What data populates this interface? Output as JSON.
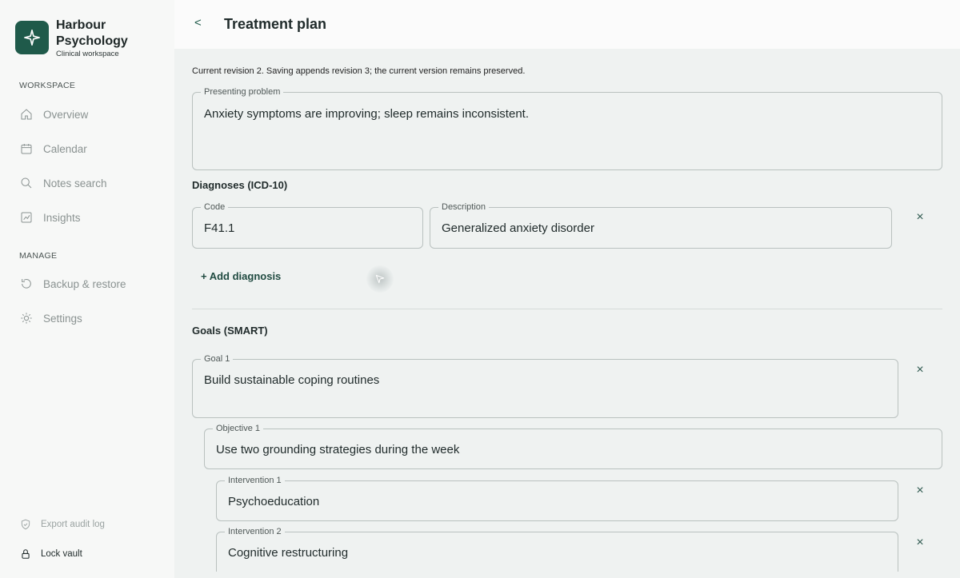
{
  "brand": {
    "name_line1": "Harbour",
    "name_line2": "Psychology",
    "subtitle": "Clinical workspace",
    "logo_icon": "sparkle-icon"
  },
  "sidebar": {
    "workspace_label": "WORKSPACE",
    "workspace_items": [
      {
        "label": "Overview",
        "icon": "home-icon"
      },
      {
        "label": "Calendar",
        "icon": "calendar-icon"
      },
      {
        "label": "Notes search",
        "icon": "search-icon"
      },
      {
        "label": "Insights",
        "icon": "chart-icon"
      }
    ],
    "manage_label": "MANAGE",
    "manage_items": [
      {
        "label": "Backup & restore",
        "icon": "restore-icon"
      },
      {
        "label": "Settings",
        "icon": "gear-icon"
      }
    ],
    "footer": {
      "export_label": "Export audit log",
      "lock_label": "Lock vault"
    }
  },
  "header": {
    "back_label": "<",
    "title": "Treatment plan"
  },
  "main": {
    "revision_note": "Current revision 2. Saving appends revision 3; the current version remains preserved.",
    "presenting_problem": {
      "label": "Presenting problem",
      "value": "Anxiety symptoms are improving; sleep remains inconsistent."
    },
    "diagnoses": {
      "title": "Diagnoses (ICD-10)",
      "code_label": "Code",
      "code_value": "F41.1",
      "description_label": "Description",
      "description_value": "Generalized anxiety disorder",
      "remove_label": "×",
      "add_label": "+ Add diagnosis"
    },
    "goals": {
      "title": "Goals (SMART)",
      "goal1_label": "Goal 1",
      "goal1_value": "Build sustainable coping routines",
      "objective1_label": "Objective 1",
      "objective1_value": "Use two grounding strategies during the week",
      "intervention1_label": "Intervention 1",
      "intervention1_value": "Psychoeducation",
      "intervention2_label": "Intervention 2",
      "intervention2_value": "Cognitive restructuring",
      "remove_label": "×"
    }
  },
  "colors": {
    "accent": "#1f5a4a",
    "sidebar_bg": "#f7f8f7",
    "main_bg": "#eff2f1",
    "muted_nav": "#8a9291"
  }
}
